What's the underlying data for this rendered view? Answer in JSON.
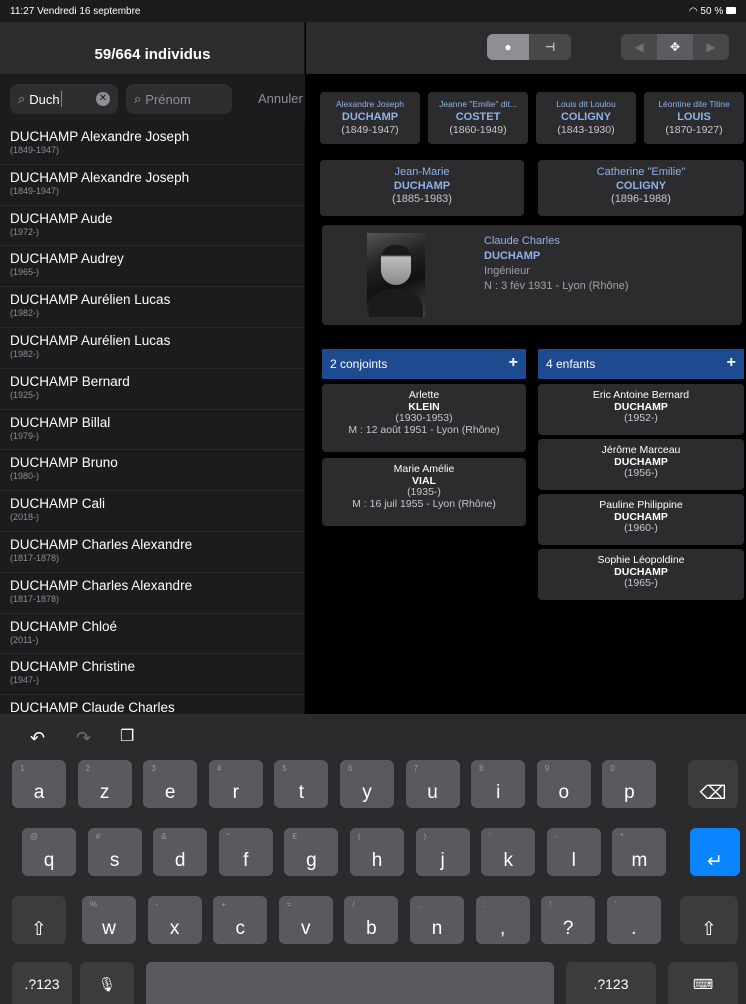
{
  "status": {
    "time": "11:27",
    "date": "Vendredi 16 septembre",
    "battery": "50 %"
  },
  "left_header": {
    "title": "59/664 individus"
  },
  "search": {
    "name_value": "Duch",
    "firstname_placeholder": "Prénom",
    "cancel": "Annuler"
  },
  "list": [
    {
      "name": "DUCHAMP Alexandre Joseph",
      "dates": "(1849-1947)"
    },
    {
      "name": "DUCHAMP Alexandre Joseph",
      "dates": "(1849-1947)"
    },
    {
      "name": "DUCHAMP Aude",
      "dates": "(1972-)"
    },
    {
      "name": "DUCHAMP Audrey",
      "dates": "(1965-)"
    },
    {
      "name": "DUCHAMP Aurélien Lucas",
      "dates": "(1982-)"
    },
    {
      "name": "DUCHAMP Aurélien Lucas",
      "dates": "(1982-)"
    },
    {
      "name": "DUCHAMP Bernard",
      "dates": "(1925-)"
    },
    {
      "name": "DUCHAMP Billal",
      "dates": "(1979-)"
    },
    {
      "name": "DUCHAMP Bruno",
      "dates": "(1980-)"
    },
    {
      "name": "DUCHAMP Cali",
      "dates": "(2018-)"
    },
    {
      "name": "DUCHAMP Charles Alexandre",
      "dates": "(1817-1878)"
    },
    {
      "name": "DUCHAMP Charles Alexandre",
      "dates": "(1817-1878)"
    },
    {
      "name": "DUCHAMP Chloé",
      "dates": "(2011-)"
    },
    {
      "name": "DUCHAMP Christine",
      "dates": "(1947-)"
    },
    {
      "name": "DUCHAMP Claude Charles",
      "dates": ""
    }
  ],
  "toolbar": {
    "eye_icon": "eye-icon",
    "tree_icon": "tree-icon",
    "prev_icon": "triangle-left-icon",
    "move_icon": "move-icon",
    "next_icon": "triangle-right-icon"
  },
  "grandparents": [
    {
      "first": "Alexandre Joseph",
      "last": "DUCHAMP",
      "dates": "(1849-1947)"
    },
    {
      "first": "Jeanne \"Emilie\" dit...",
      "last": "COSTET",
      "dates": "(1860-1949)"
    },
    {
      "first": "Louis dit Loulou",
      "last": "COLIGNY",
      "dates": "(1843-1930)"
    },
    {
      "first": "Léontine dite Titine",
      "last": "LOUIS",
      "dates": "(1870-1927)"
    }
  ],
  "parents": [
    {
      "first": "Jean-Marie",
      "last": "DUCHAMP",
      "dates": "(1885-1983)"
    },
    {
      "first": "Catherine \"Emilie\"",
      "last": "COLIGNY",
      "dates": "(1896-1988)"
    }
  ],
  "person": {
    "first": "Claude Charles",
    "last": "DUCHAMP",
    "occupation": "Ingénieur",
    "birth": "N : 3 fév 1931 - Lyon (Rhône)"
  },
  "spouses": {
    "header": "2 conjoints",
    "plus": "+",
    "items": [
      {
        "first": "Arlette",
        "last": "KLEIN",
        "dates": "(1930-1953)",
        "marriage": "M : 12 août 1951 - Lyon (Rhône)"
      },
      {
        "first": "Marie Amélie",
        "last": "VIAL",
        "dates": "(1935-)",
        "marriage": "M : 16 juil 1955 - Lyon (Rhône)"
      }
    ]
  },
  "children": {
    "header": "4 enfants",
    "plus": "+",
    "items": [
      {
        "first": "Eric Antoine Bernard",
        "last": "DUCHAMP",
        "dates": "(1952-)"
      },
      {
        "first": "Jérôme Marceau",
        "last": "DUCHAMP",
        "dates": "(1956-)"
      },
      {
        "first": "Pauline Philippine",
        "last": "DUCHAMP",
        "dates": "(1960-)"
      },
      {
        "first": "Sophie Léopoldine",
        "last": "DUCHAMP",
        "dates": "(1965-)"
      }
    ]
  },
  "keyboard": {
    "row1": [
      {
        "k": "a",
        "s": "1"
      },
      {
        "k": "z",
        "s": "2"
      },
      {
        "k": "e",
        "s": "3"
      },
      {
        "k": "r",
        "s": "4"
      },
      {
        "k": "t",
        "s": "5"
      },
      {
        "k": "y",
        "s": "6"
      },
      {
        "k": "u",
        "s": "7"
      },
      {
        "k": "i",
        "s": "8"
      },
      {
        "k": "o",
        "s": "9"
      },
      {
        "k": "p",
        "s": "0"
      }
    ],
    "row2": [
      {
        "k": "q",
        "s": "@"
      },
      {
        "k": "s",
        "s": "#"
      },
      {
        "k": "d",
        "s": "&"
      },
      {
        "k": "f",
        "s": "\""
      },
      {
        "k": "g",
        "s": "€"
      },
      {
        "k": "h",
        "s": "("
      },
      {
        "k": "j",
        "s": ")"
      },
      {
        "k": "k",
        "s": "'"
      },
      {
        "k": "l",
        "s": "-"
      },
      {
        "k": "m",
        "s": "*"
      }
    ],
    "row3": [
      {
        "k": "w",
        "s": "%"
      },
      {
        "k": "x",
        "s": "-"
      },
      {
        "k": "c",
        "s": "+"
      },
      {
        "k": "v",
        "s": "="
      },
      {
        "k": "b",
        "s": "/"
      },
      {
        "k": "n",
        "s": ";"
      },
      {
        "k": ",",
        "s": ":"
      },
      {
        "k": "?",
        "s": "!"
      },
      {
        "k": ".",
        "s": "'"
      }
    ],
    "numbers_label": ".?123",
    "icons": {
      "undo": "undo-icon",
      "redo": "redo-icon",
      "paste": "clipboard-icon",
      "backspace": "backspace-icon",
      "return": "return-icon",
      "shift": "shift-icon",
      "mic": "mic-icon",
      "hide": "keyboard-icon"
    }
  }
}
